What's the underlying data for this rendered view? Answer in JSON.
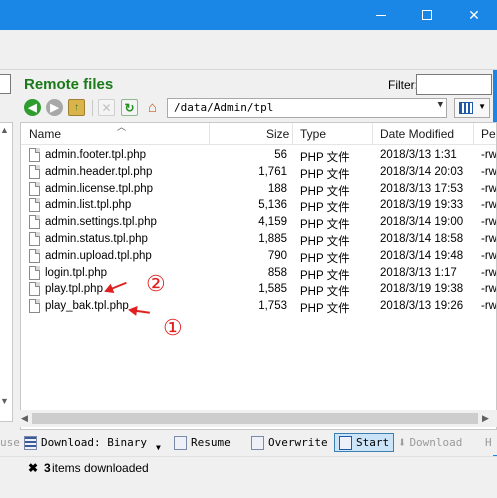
{
  "window": {
    "controls": {
      "minimize": "—",
      "maximize": "☐",
      "close": "✕"
    },
    "accent_color": "#1a87e6"
  },
  "remote": {
    "title": "Remote files",
    "filter_label": "Filter:",
    "filter_value": "",
    "path": "/data/Admin/tpl",
    "title_color": "#1a7a1a"
  },
  "toolbar_icons": [
    "back-icon",
    "forward-icon",
    "up-folder-icon",
    "delete-icon",
    "refresh-icon",
    "home-icon",
    "view-list-icon"
  ],
  "columns": {
    "name": "Name",
    "size": "Size",
    "type": "Type",
    "date": "Date Modified",
    "perm": "Pe"
  },
  "files": [
    {
      "name": "admin.footer.tpl.php",
      "size": "56",
      "type": "PHP 文件",
      "date": "2018/3/13 1:31",
      "perm": "-rw-"
    },
    {
      "name": "admin.header.tpl.php",
      "size": "1,761",
      "type": "PHP 文件",
      "date": "2018/3/14 20:03",
      "perm": "-rw-"
    },
    {
      "name": "admin.license.tpl.php",
      "size": "188",
      "type": "PHP 文件",
      "date": "2018/3/13 17:53",
      "perm": "-rw-"
    },
    {
      "name": "admin.list.tpl.php",
      "size": "5,136",
      "type": "PHP 文件",
      "date": "2018/3/19 19:33",
      "perm": "-rw-"
    },
    {
      "name": "admin.settings.tpl.php",
      "size": "4,159",
      "type": "PHP 文件",
      "date": "2018/3/14 19:00",
      "perm": "-rw-"
    },
    {
      "name": "admin.status.tpl.php",
      "size": "1,885",
      "type": "PHP 文件",
      "date": "2018/3/14 18:58",
      "perm": "-rw-"
    },
    {
      "name": "admin.upload.tpl.php",
      "size": "790",
      "type": "PHP 文件",
      "date": "2018/3/14 19:48",
      "perm": "-rw-"
    },
    {
      "name": "login.tpl.php",
      "size": "858",
      "type": "PHP 文件",
      "date": "2018/3/13 1:17",
      "perm": "-rw-"
    },
    {
      "name": "play.tpl.php",
      "size": "1,585",
      "type": "PHP 文件",
      "date": "2018/3/19 19:38",
      "perm": "-rw-"
    },
    {
      "name": "play_bak.tpl.php",
      "size": "1,753",
      "type": "PHP 文件",
      "date": "2018/3/13 19:26",
      "perm": "-rw-"
    }
  ],
  "annotations": {
    "one": "①",
    "two": "②",
    "color": "#e02020"
  },
  "queue": {
    "left_cut": "use",
    "download_mode": "Download: Binary",
    "resume": "Resume",
    "overwrite": "Overwrite",
    "start": "Start",
    "download": "Download",
    "right_cut": "H"
  },
  "status": {
    "close_symbol": "✖",
    "count": "3",
    "text": "items downloaded"
  }
}
